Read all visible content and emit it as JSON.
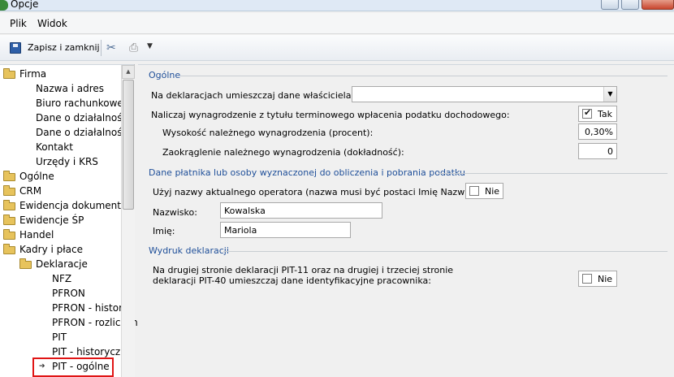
{
  "window": {
    "title": "Opcje"
  },
  "menu": {
    "items": [
      "Plik",
      "Widok"
    ]
  },
  "toolbar": {
    "save_label": "Zapisz i zamknij"
  },
  "tree": {
    "items": [
      {
        "label": "Firma",
        "type": "folder"
      },
      {
        "label": "Nazwa i adres",
        "type": "leaf"
      },
      {
        "label": "Biuro rachunkowe",
        "type": "leaf"
      },
      {
        "label": "Dane o działalności",
        "type": "leaf"
      },
      {
        "label": "Dane o działalności",
        "type": "leaf"
      },
      {
        "label": "Kontakt",
        "type": "leaf"
      },
      {
        "label": "Urzędy i KRS",
        "type": "leaf"
      },
      {
        "label": "Ogólne",
        "type": "folder"
      },
      {
        "label": "CRM",
        "type": "folder"
      },
      {
        "label": "Ewidencja dokumentów",
        "type": "folder"
      },
      {
        "label": "Ewidencje ŚP",
        "type": "folder"
      },
      {
        "label": "Handel",
        "type": "folder"
      },
      {
        "label": "Kadry i płace",
        "type": "folder"
      },
      {
        "label": "Deklaracje",
        "type": "folder"
      },
      {
        "label": "NFZ",
        "type": "leaf"
      },
      {
        "label": "PFRON",
        "type": "leaf"
      },
      {
        "label": "PFRON - historia",
        "type": "leaf"
      },
      {
        "label": "PFRON - rozliczenie",
        "type": "leaf"
      },
      {
        "label": "PIT",
        "type": "leaf"
      },
      {
        "label": "PIT - historyczne",
        "type": "leaf"
      },
      {
        "label": "PIT - ogólne",
        "type": "leaf",
        "selected": true
      }
    ]
  },
  "main": {
    "section1": {
      "title": "Ogólne",
      "owner_label": "Na deklaracjach umieszczaj dane właściciela:",
      "owner_value": "",
      "accrue_label": "Naliczaj wynagrodzenie z tytułu terminowego wpłacenia podatku dochodowego:",
      "accrue_checked": true,
      "accrue_text": "Tak",
      "percent_label": "Wysokość należnego wynagrodzenia (procent):",
      "percent_value": "0,30%",
      "rounding_label": "Zaokrąglenie należnego wynagrodzenia (dokładność):",
      "rounding_value": "0"
    },
    "section2": {
      "title": "Dane płatnika lub osoby wyznaczonej do obliczenia i pobrania podatku",
      "operator_label": "Użyj nazwy aktualnego operatora (nazwa musi być postaci Imię Nazwisko):",
      "operator_checked": false,
      "operator_text": "Nie",
      "surname_label": "Nazwisko:",
      "surname_value": "Kowalska",
      "name_label": "Imię:",
      "name_value": "Mariola"
    },
    "section3": {
      "title": "Wydruk deklaracji",
      "print_line1": "Na drugiej stronie deklaracji PIT-11 oraz na drugiej i trzeciej stronie",
      "print_line2": "deklaracji PIT-40 umieszczaj dane identyfikacyjne pracownika:",
      "print_checked": false,
      "print_text": "Nie"
    }
  }
}
